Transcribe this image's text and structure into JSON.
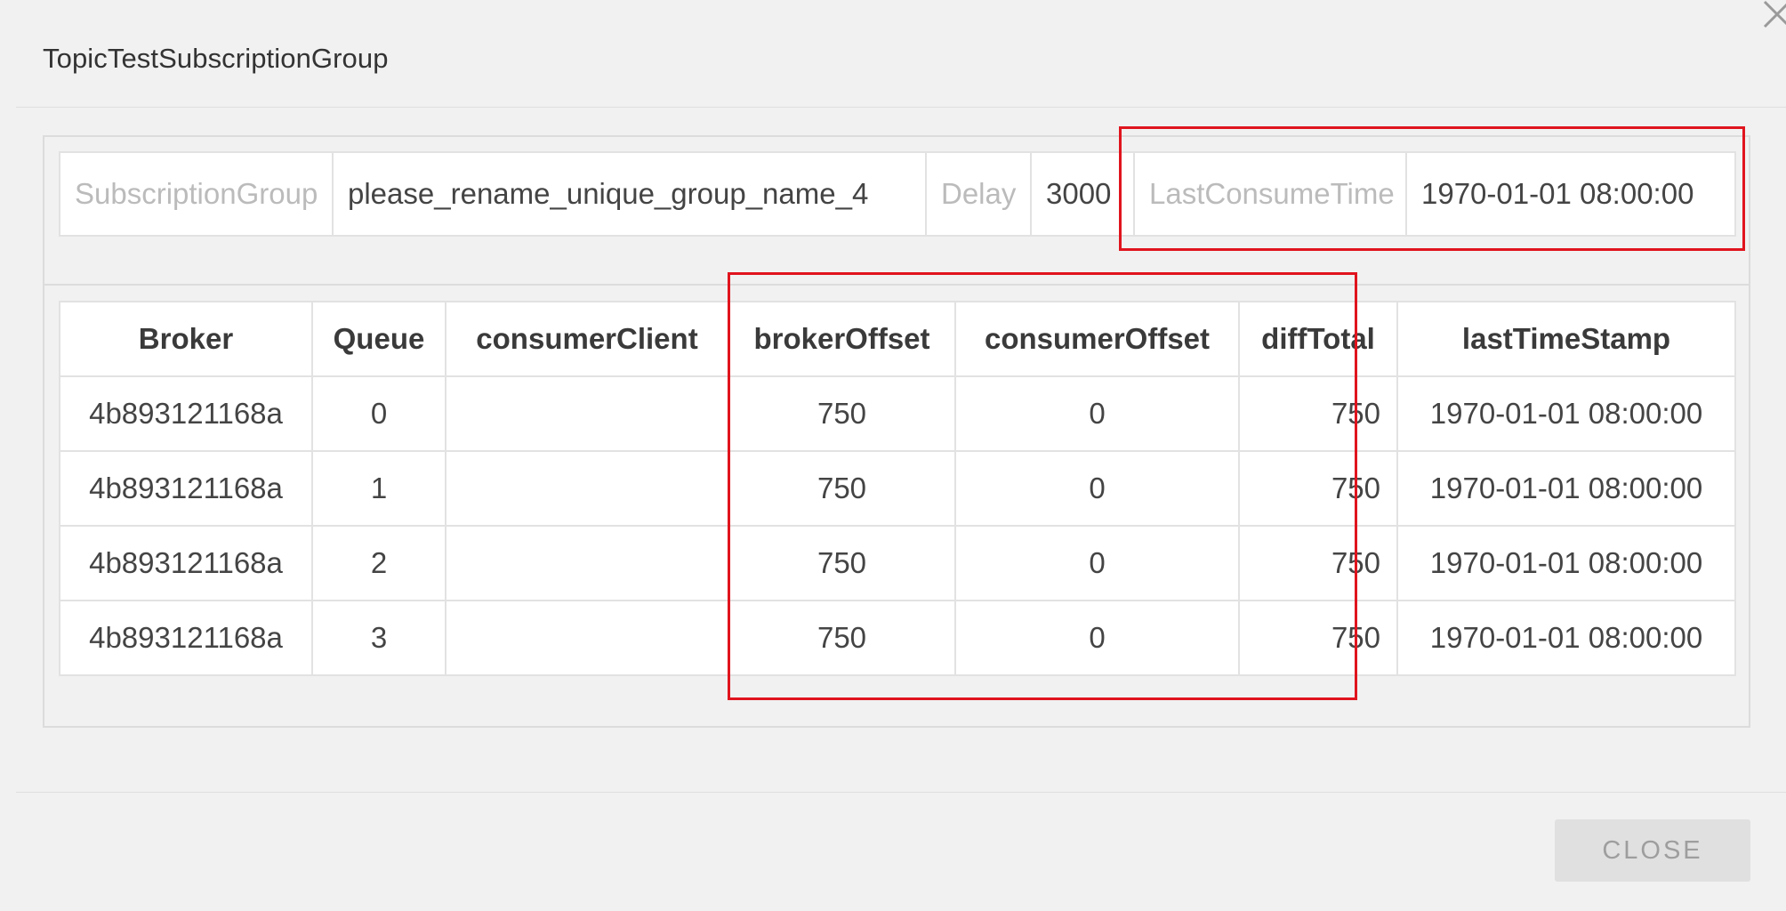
{
  "dialog": {
    "title": "TopicTestSubscriptionGroup",
    "close_button_label": "CLOSE",
    "close_icon": "close-icon"
  },
  "info": {
    "subscription_group_label": "SubscriptionGroup",
    "subscription_group_value": "please_rename_unique_group_name_4",
    "delay_label": "Delay",
    "delay_value": "3000",
    "last_consume_time_label": "LastConsumeTime",
    "last_consume_time_value": "1970-01-01 08:00:00"
  },
  "table": {
    "columns": [
      "Broker",
      "Queue",
      "consumerClient",
      "brokerOffset",
      "consumerOffset",
      "diffTotal",
      "lastTimeStamp"
    ],
    "rows": [
      [
        "4b893121168a",
        "0",
        "",
        "750",
        "0",
        "750",
        "1970-01-01 08:00:00"
      ],
      [
        "4b893121168a",
        "1",
        "",
        "750",
        "0",
        "750",
        "1970-01-01 08:00:00"
      ],
      [
        "4b893121168a",
        "2",
        "",
        "750",
        "0",
        "750",
        "1970-01-01 08:00:00"
      ],
      [
        "4b893121168a",
        "3",
        "",
        "750",
        "0",
        "750",
        "1970-01-01 08:00:00"
      ]
    ]
  },
  "colors": {
    "highlight": "#e0141e",
    "background": "#f1f1f1"
  }
}
